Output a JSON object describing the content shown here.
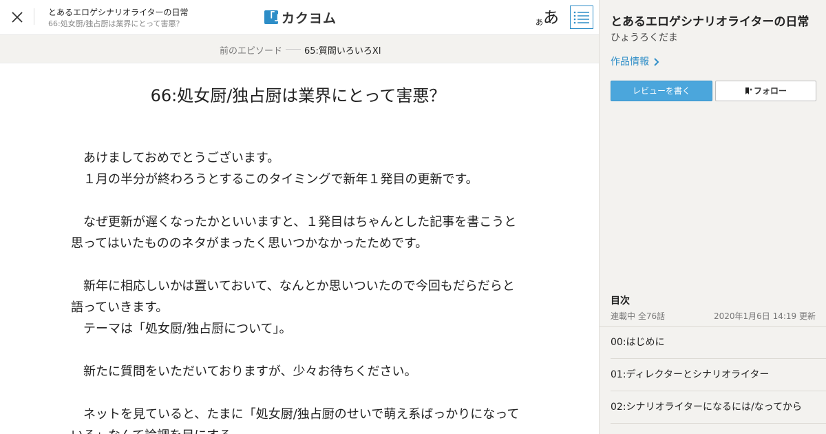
{
  "header": {
    "work_title": "とあるエロゲシナリオライターの日常",
    "episode_title": "66:処女厨/独占厨は業界にとって害悪？",
    "logo_text": "カクヨム",
    "logo_mark": "「」",
    "font_size_small": "あ",
    "font_size_large": "あ",
    "accent_color": "#2d8dc7"
  },
  "episode_nav": {
    "prev_label": "前のエピソード",
    "prev_title": "65:質問いろいろXl"
  },
  "episode": {
    "title": "66:処女厨/独占厨は業界にとって害悪？",
    "paragraphs": [
      "　あけましておめでとうございます。",
      "　１月の半分が終わろうとするこのタイミングで新年１発目の更新です。",
      "",
      "　なぜ更新が遅くなったかといいますと、１発目はちゃんとした記事を書こうと",
      "思ってはいたもののネタがまったく思いつかなかったためです。",
      "",
      "　新年に相応しいかは置いておいて、なんとか思いついたので今回もだらだらと",
      "語っていきます。",
      "　テーマは「処女厨/独占厨について」。",
      "",
      "　新たに質問をいただいておりますが、少々お待ちください。",
      "",
      "　ネットを見ていると、たまに「処女厨/独占厨のせいで萌え系ばっかりになって",
      "いる」なんて論調を目にする。"
    ]
  },
  "sidebar": {
    "work_title": "とあるエロゲシナリオライターの日常",
    "author": "ひょうろくだま",
    "work_info_label": "作品情報",
    "review_button": "レビューを書く",
    "follow_button": "フォロー",
    "toc_heading": "目次",
    "toc_status": "連載中 全76話",
    "toc_updated": "2020年1月6日 14:19 更新",
    "toc_items": [
      "00:はじめに",
      "01:ディレクターとシナリオライター",
      "02:シナリオライターになるには/なってから"
    ]
  }
}
